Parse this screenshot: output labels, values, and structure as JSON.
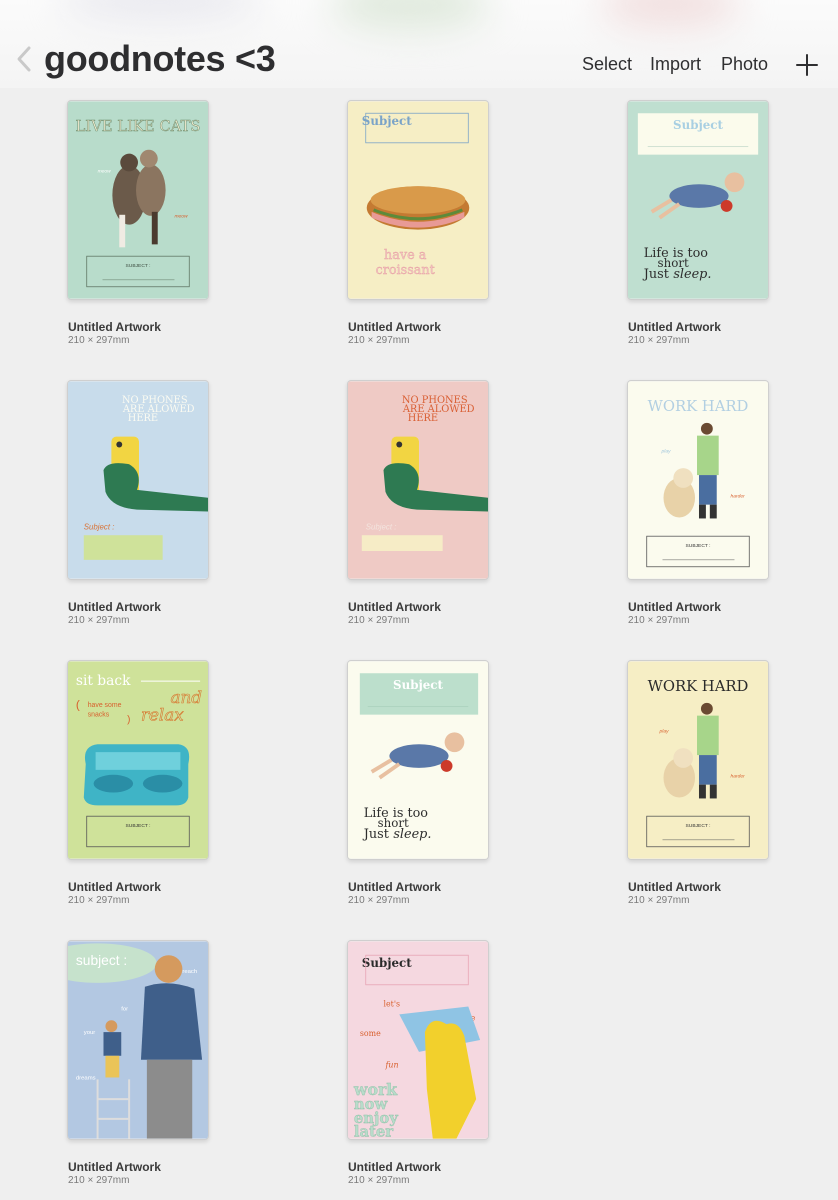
{
  "header": {
    "title": "goodnotes <3",
    "select_label": "Select",
    "import_label": "Import",
    "photo_label": "Photo"
  },
  "artworks": [
    {
      "title": "Untitled Artwork",
      "size": "210 × 297mm",
      "cover_text": [
        "LIVE LIKE CATS",
        "meow",
        "meow",
        "SUBJECT :"
      ]
    },
    {
      "title": "Untitled Artwork",
      "size": "210 × 297mm",
      "cover_text": [
        "Subject",
        "have a",
        "croissant"
      ]
    },
    {
      "title": "Untitled Artwork",
      "size": "210 × 297mm",
      "cover_text": [
        "Subject",
        "Life is too",
        "short",
        "Just",
        "sleep."
      ]
    },
    {
      "title": "Untitled Artwork",
      "size": "210 × 297mm",
      "cover_text": [
        "NO PHONES",
        "ARE ALOWED",
        "HERE",
        "Subject :"
      ]
    },
    {
      "title": "Untitled Artwork",
      "size": "210 × 297mm",
      "cover_text": [
        "NO PHONES",
        "ARE ALOWED",
        "HERE",
        "Subject :"
      ]
    },
    {
      "title": "Untitled Artwork",
      "size": "210 × 297mm",
      "cover_text": [
        "WORK HARD",
        "play",
        "harder",
        "SUBJECT :"
      ]
    },
    {
      "title": "Untitled Artwork",
      "size": "210 × 297mm",
      "cover_text": [
        "sit back",
        "and",
        "relax",
        "(",
        "have some",
        "snacks",
        ")",
        "SUBJECT :"
      ]
    },
    {
      "title": "Untitled Artwork",
      "size": "210 × 297mm",
      "cover_text": [
        "Subject",
        "Life is too",
        "short",
        "Just",
        "sleep."
      ]
    },
    {
      "title": "Untitled Artwork",
      "size": "210 × 297mm",
      "cover_text": [
        "WORK HARD",
        "play",
        "harder",
        "SUBJECT :"
      ]
    },
    {
      "title": "Untitled Artwork",
      "size": "210 × 297mm",
      "cover_text": [
        "subject :",
        "reach",
        "for",
        "your",
        "dreams"
      ]
    },
    {
      "title": "Untitled Artwork",
      "size": "210 × 297mm",
      "cover_text": [
        "Subject",
        "let's",
        "have",
        "some",
        "fun",
        "work",
        "now",
        "enjoy",
        "later"
      ]
    }
  ]
}
